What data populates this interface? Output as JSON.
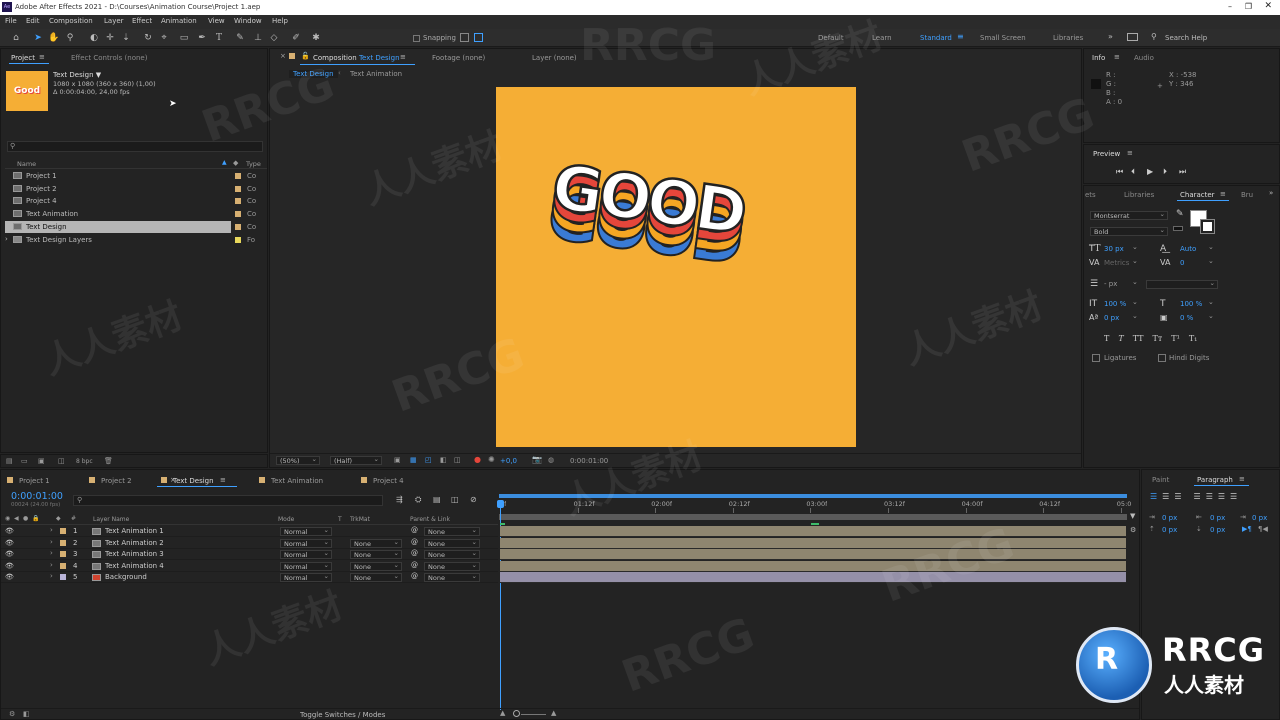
{
  "window": {
    "title": "Adobe After Effects 2021 - D:\\Courses\\Animation Course\\Project 1.aep",
    "app_badge": "Ae"
  },
  "menu": [
    "File",
    "Edit",
    "Composition",
    "Layer",
    "Effect",
    "Animation",
    "View",
    "Window",
    "Help"
  ],
  "toolbar": {
    "snapping": "Snapping",
    "workspaces": [
      "Default",
      "Learn",
      "Standard",
      "Small Screen",
      "Libraries"
    ],
    "active_workspace": "Standard",
    "search_placeholder": "Search Help"
  },
  "project": {
    "tab": "Project",
    "effect_controls": "Effect Controls (none)",
    "thumb_text": "Good",
    "selected_name": "Text Design ▼",
    "selected_size": "1080 x 1080  (360 x 360) (1,00)",
    "selected_duration": "Δ 0:00:04:00, 24,00 fps",
    "col_name": "Name",
    "col_type": "Type",
    "items": [
      {
        "name": "Project 1",
        "type": "Co"
      },
      {
        "name": "Project 2",
        "type": "Co"
      },
      {
        "name": "Project 4",
        "type": "Co"
      },
      {
        "name": "Text Animation",
        "type": "Co"
      },
      {
        "name": "Text Design",
        "type": "Co"
      },
      {
        "name": "Text Design Layers",
        "type": "Fo"
      }
    ],
    "selected_index": 4,
    "bpc": "8 bpc"
  },
  "comp_viewer": {
    "tab_prefix": "Composition",
    "tab_name": "Text Design",
    "footage": "Footage (none)",
    "layer": "Layer (none)",
    "breadcrumb": [
      "Text Design",
      "Text Animation"
    ],
    "canvas_color": "#F5AE35",
    "artwork_text": "GOOD",
    "zoom": "(50%)",
    "resolution": "(Half)",
    "exposure": "+0,0",
    "timecode": "0:00:01:00"
  },
  "info": {
    "tab": "Info",
    "audio": "Audio",
    "labels": [
      "R :",
      "G :",
      "B :",
      "A : 0"
    ],
    "x": "X : -538",
    "y": "Y : 346"
  },
  "preview": {
    "tab": "Preview"
  },
  "character": {
    "tabs": [
      "ets",
      "Libraries",
      "Character",
      "Bru"
    ],
    "font": "Montserrat",
    "style": "Bold",
    "size": "30 px",
    "leading": "Auto",
    "kerning": "Metrics",
    "tracking": "0",
    "stroke": "- px",
    "vscale": "100 %",
    "hscale": "100 %",
    "baseline": "0 px",
    "tsume": "0 %",
    "ligatures": "Ligatures",
    "hindi": "Hindi Digits"
  },
  "paragraph": {
    "tabs": [
      "Paint",
      "Paragraph"
    ],
    "values": [
      "0 px",
      "0 px",
      "0 px",
      "0 px",
      "0 px"
    ]
  },
  "timeline": {
    "tabs": [
      "Project 1",
      "Project 2",
      "Text Design",
      "Text Animation",
      "Project 4"
    ],
    "active_tab": "Text Design",
    "current_time": "0:00:01:00",
    "frame_info": "00024 (24.00 fps)",
    "headers": {
      "layer_name": "Layer Name",
      "mode": "Mode",
      "t": "T",
      "trkmat": "TrkMat",
      "parent": "Parent & Link"
    },
    "layers": [
      {
        "num": "1",
        "name": "Text Animation 1",
        "mode": "Normal",
        "trkmat": "",
        "parent": "None"
      },
      {
        "num": "2",
        "name": "Text Animation 2",
        "mode": "Normal",
        "trkmat": "None",
        "parent": "None"
      },
      {
        "num": "3",
        "name": "Text Animation 3",
        "mode": "Normal",
        "trkmat": "None",
        "parent": "None"
      },
      {
        "num": "4",
        "name": "Text Animation 4",
        "mode": "Normal",
        "trkmat": "None",
        "parent": "None"
      },
      {
        "num": "5",
        "name": "Background",
        "mode": "Normal",
        "trkmat": "None",
        "parent": "None"
      }
    ],
    "ruler": [
      "0f",
      "01:12f",
      "02:00f",
      "02:12f",
      "03:00f",
      "03:12f",
      "04:00f",
      "04:12f",
      "05:0"
    ],
    "toggle": "Toggle Switches / Modes"
  },
  "watermarks": [
    "RRCG",
    "人人素材"
  ],
  "logo": {
    "big": "RRCG",
    "small": "人人素材"
  }
}
